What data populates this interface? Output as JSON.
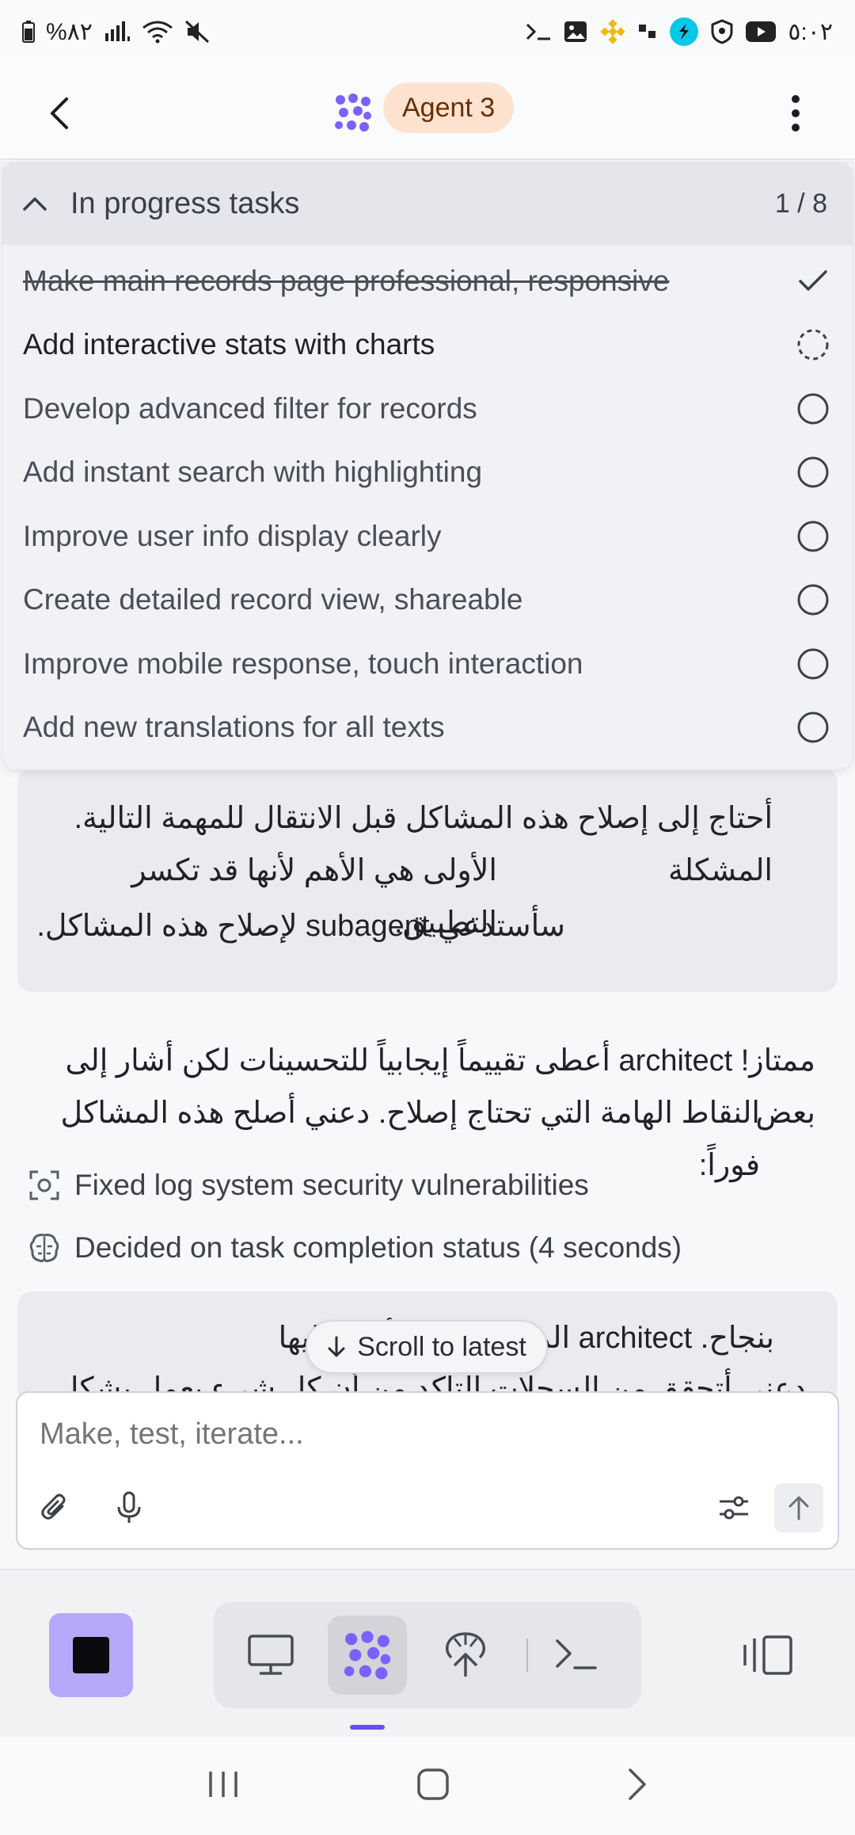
{
  "status_bar": {
    "battery": "%٨٢",
    "time": "٥:٠٢"
  },
  "header": {
    "agent_label": "Agent 3"
  },
  "tasks_panel": {
    "title": "In progress tasks",
    "count": "1 / 8",
    "items": [
      {
        "label": "Make main records page professional, responsive",
        "state": "done"
      },
      {
        "label": "Add interactive stats with charts",
        "state": "in-progress"
      },
      {
        "label": "Develop advanced filter for records",
        "state": "pending"
      },
      {
        "label": "Add instant search with highlighting",
        "state": "pending"
      },
      {
        "label": "Improve user info display clearly",
        "state": "pending"
      },
      {
        "label": "Create detailed record view, shareable",
        "state": "pending"
      },
      {
        "label": "Improve mobile response, touch interaction",
        "state": "pending"
      },
      {
        "label": "Add new translations for all texts",
        "state": "pending"
      }
    ]
  },
  "chat": {
    "bubble1": {
      "line1": "أحتاج إلى إصلاح هذه المشاكل قبل الانتقال للمهمة التالية. المشكلة",
      "line2": "الأولى هي الأهم لأنها قد تكسر التطبيق.",
      "line3": "سأستدعي subagent لإصلاح هذه المشاكل."
    },
    "message": {
      "line1": "ممتاز! architect أعطى تقييماً إيجابياً للتحسينات لكن أشار إلى بعض",
      "line2": "النقاط الهامة التي تحتاج إصلاح. دعني أصلح هذه المشاكل فوراً:"
    },
    "log_items": [
      {
        "icon": "scan-icon",
        "text": "Fixed log system security vulnerabilities"
      },
      {
        "icon": "brain-icon",
        "text": "Decided on task completion status (4 seconds)"
      }
    ],
    "bubble2": {
      "line1": "بنجاح. architect المشاكل التي أشار إليها",
      "line2": "دعني أتحقق من السجلات التأكد من أن كل شيء يعمل بشكل صحيح"
    }
  },
  "scroll_button": {
    "label": "Scroll to latest"
  },
  "composer": {
    "placeholder": "Make, test, iterate..."
  },
  "colors": {
    "accent": "#7b61ff",
    "agent_pill_bg": "#fde3cf",
    "stop_button_bg": "#b7a8fb"
  }
}
